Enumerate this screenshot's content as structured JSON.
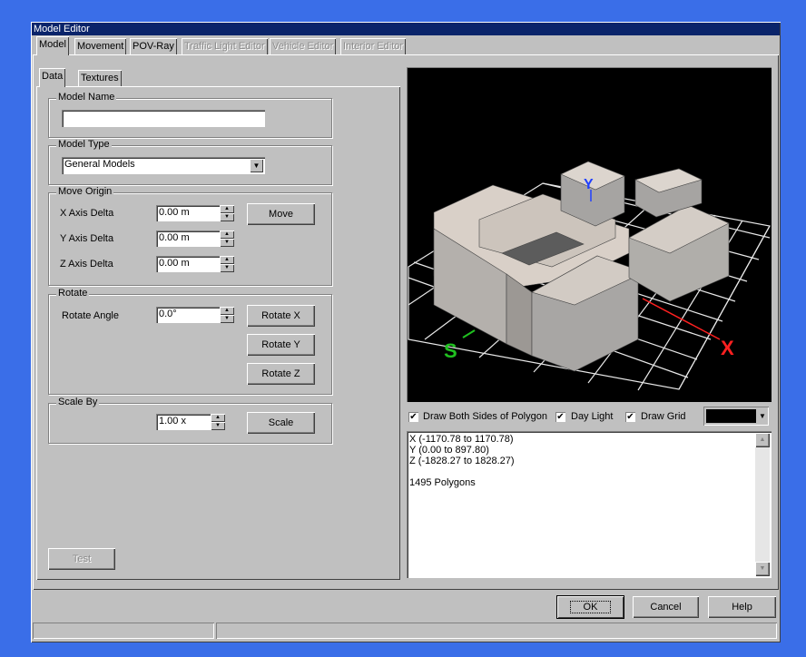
{
  "window": {
    "title": "Model Editor"
  },
  "tabs": [
    "Model",
    "Movement",
    "POV-Ray",
    "Traffic Light Editor",
    "Vehicle Editor",
    "Interior Editor"
  ],
  "subtabs": [
    "Data",
    "Textures"
  ],
  "model_name": {
    "label": "Model Name",
    "value": ""
  },
  "model_type": {
    "label": "Model Type",
    "value": "General Models"
  },
  "move_origin": {
    "label": "Move Origin",
    "x_label": "X Axis Delta",
    "x_value": "0.00 m",
    "y_label": "Y Axis Delta",
    "y_value": "0.00 m",
    "z_label": "Z Axis Delta",
    "z_value": "0.00 m",
    "move_button": "Move"
  },
  "rotate": {
    "label": "Rotate",
    "angle_label": "Rotate Angle",
    "angle_value": "0.0°",
    "rotate_x": "Rotate X",
    "rotate_y": "Rotate Y",
    "rotate_z": "Rotate Z"
  },
  "scale": {
    "label": "Scale By",
    "value": "1.00 x",
    "button": "Scale"
  },
  "test_button": "Test",
  "viewport": {
    "axis_x": "X",
    "axis_y": "Y",
    "axis_z": "S"
  },
  "options": {
    "draw_both_sides": "Draw Both Sides of Polygon",
    "day_light": "Day Light",
    "draw_grid": "Draw Grid"
  },
  "info": {
    "x_range": "X (-1170.78 to 1170.78)",
    "y_range": "Y (0.00 to 897.80)",
    "z_range": "Z (-1828.27 to 1828.27)",
    "polygons": "1495 Polygons"
  },
  "footer": {
    "ok": "OK",
    "cancel": "Cancel",
    "help": "Help"
  },
  "colors": {
    "titlebar": "#0a246a",
    "desktop": "#3a6ee8",
    "face": "#c0c0c0",
    "axis_x": "#ff2020",
    "axis_y": "#2040ff",
    "axis_z": "#20c020"
  }
}
